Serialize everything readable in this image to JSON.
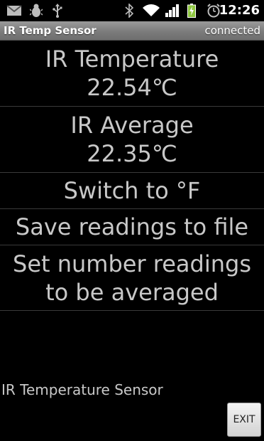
{
  "status_bar": {
    "time": "12:26",
    "icons": [
      "gmail-icon",
      "android-debug-icon",
      "usb-icon",
      "bluetooth-icon",
      "wifi-icon",
      "signal-icon",
      "battery-charging-icon",
      "alarm-icon"
    ]
  },
  "title_bar": {
    "title": "IR Temp Sensor",
    "status": "connected"
  },
  "readings": {
    "ir_temperature": {
      "label": "IR Temperature",
      "value": "22.54℃"
    },
    "ir_average": {
      "label": "IR Average",
      "value": "22.35℃"
    }
  },
  "actions": {
    "switch_unit": "Switch to °F",
    "save_readings": "Save readings to file",
    "set_number_line1": "Set number readings",
    "set_number_line2": "to be averaged"
  },
  "footer": {
    "label": "IR Temperature Sensor",
    "exit_button": "EXIT"
  },
  "colors": {
    "background": "#000000",
    "text": "#c8c8c8",
    "title_bar": "#7a7a7a",
    "battery": "#8ec63f"
  }
}
